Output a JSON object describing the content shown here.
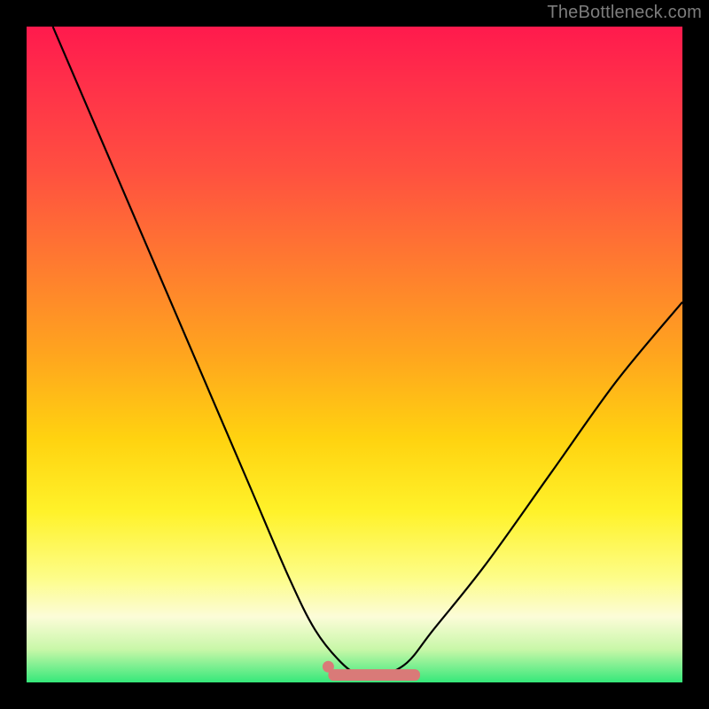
{
  "watermark": "TheBottleneck.com",
  "chart_data": {
    "type": "line",
    "title": "",
    "xlabel": "",
    "ylabel": "",
    "xlim": [
      0,
      100
    ],
    "ylim": [
      0,
      100
    ],
    "series": [
      {
        "name": "bottleneck-curve",
        "color": "#000000",
        "x": [
          4,
          10,
          16,
          22,
          28,
          34,
          40,
          44,
          48,
          51,
          54,
          58,
          62,
          70,
          80,
          90,
          100
        ],
        "values": [
          100,
          86,
          72,
          58,
          44,
          30,
          16,
          8,
          3,
          1,
          1,
          3,
          8,
          18,
          32,
          46,
          58
        ]
      }
    ],
    "marker_band": {
      "name": "optimal-range",
      "color": "#d97a78",
      "x_start": 46,
      "x_end": 60,
      "y": 1.2
    },
    "marker_dot": {
      "name": "start-dot",
      "color": "#d97a78",
      "x": 46,
      "y": 2.4
    }
  }
}
